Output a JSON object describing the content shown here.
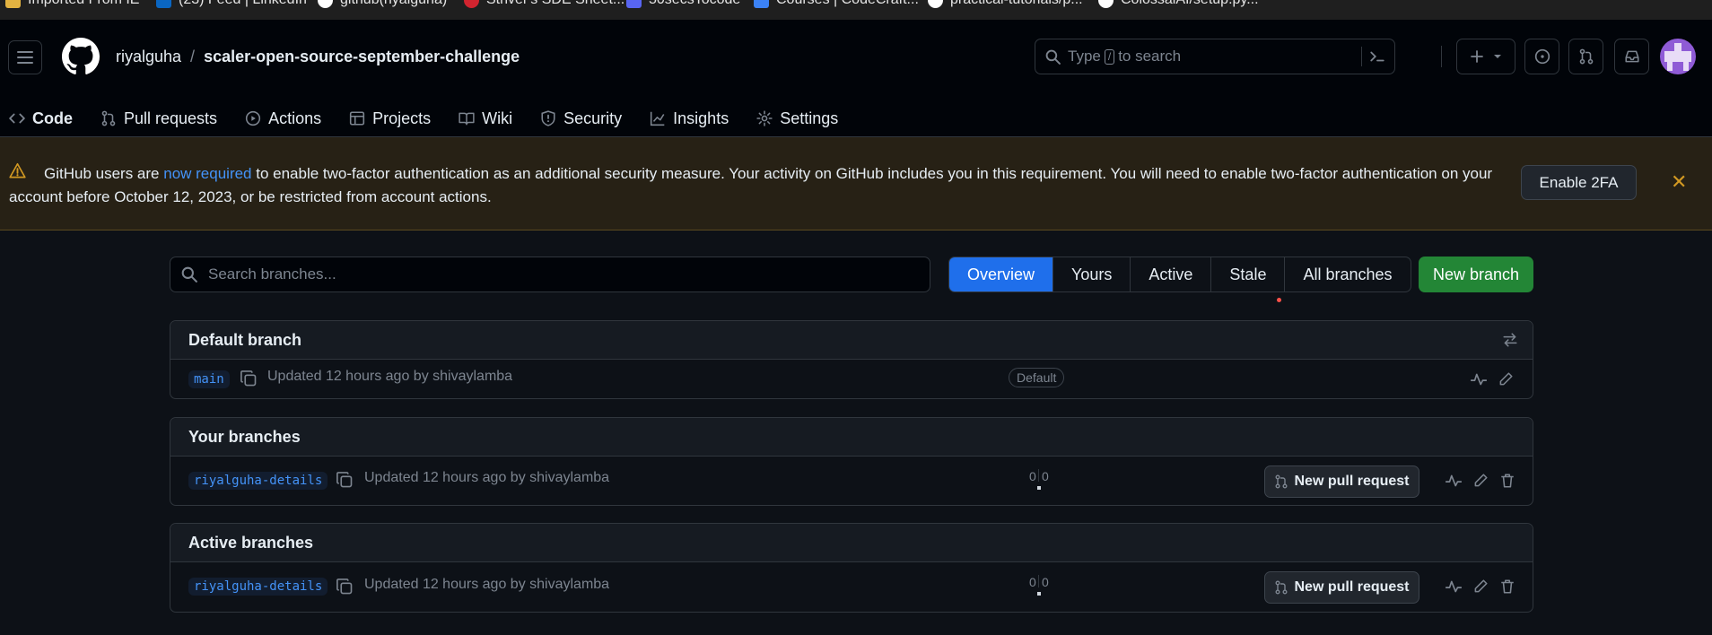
{
  "bookmarks": [
    {
      "label": "Imported From IE",
      "color": "#e3b341"
    },
    {
      "label": "(23) Feed | LinkedIn",
      "color": "#0a66c2"
    },
    {
      "label": "github(riyalguha)",
      "color": "#ffffff"
    },
    {
      "label": "Striver's SDE Sheet...",
      "color": "#d1242f"
    },
    {
      "label": "50secsTocode",
      "color": "#5865f2"
    },
    {
      "label": "Courses | CodeCraft...",
      "color": "#3b82f6"
    },
    {
      "label": "practical-tutorials/p...",
      "color": "#ffffff"
    },
    {
      "label": "ColossalAI/setup.py...",
      "color": "#ffffff"
    }
  ],
  "header": {
    "owner": "riyalguha",
    "separator": "/",
    "repo": "scaler-open-source-september-challenge",
    "search_prefix": "Type",
    "search_key": "/",
    "search_suffix": "to search"
  },
  "tabs": [
    {
      "label": "Code",
      "icon": "code-icon"
    },
    {
      "label": "Pull requests",
      "icon": "pull-request-icon"
    },
    {
      "label": "Actions",
      "icon": "play-icon"
    },
    {
      "label": "Projects",
      "icon": "table-icon"
    },
    {
      "label": "Wiki",
      "icon": "book-icon"
    },
    {
      "label": "Security",
      "icon": "shield-icon"
    },
    {
      "label": "Insights",
      "icon": "graph-icon"
    },
    {
      "label": "Settings",
      "icon": "gear-icon"
    }
  ],
  "banner": {
    "before_link": "GitHub users are ",
    "link": "now required",
    "after_link": " to enable two-factor authentication as an additional security measure. Your activity on GitHub includes you in this requirement. You will need to enable two-factor authentication on your account before October 12, 2023, or be restricted from account actions.",
    "button": "Enable 2FA"
  },
  "branches_toolbar": {
    "search_placeholder": "Search branches...",
    "filters": [
      "Overview",
      "Yours",
      "Active",
      "Stale",
      "All branches"
    ],
    "new_branch": "New branch"
  },
  "sections": {
    "default": {
      "title": "Default branch",
      "branch": "main",
      "updated": "Updated 12 hours ago by shivaylamba",
      "badge": "Default"
    },
    "yours": {
      "title": "Your branches",
      "branch": "riyalguha-details",
      "updated": "Updated 12 hours ago by shivaylamba",
      "behind": "0",
      "ahead": "0",
      "pr_button": "New pull request"
    },
    "active": {
      "title": "Active branches",
      "branch": "riyalguha-details",
      "updated": "Updated 12 hours ago by shivaylamba",
      "behind": "0",
      "ahead": "0",
      "pr_button": "New pull request"
    }
  },
  "colors": {
    "accent": "#1f6feb",
    "primary_button": "#238636",
    "active_tab_underline": "#f78166",
    "warning": "#d29922"
  }
}
